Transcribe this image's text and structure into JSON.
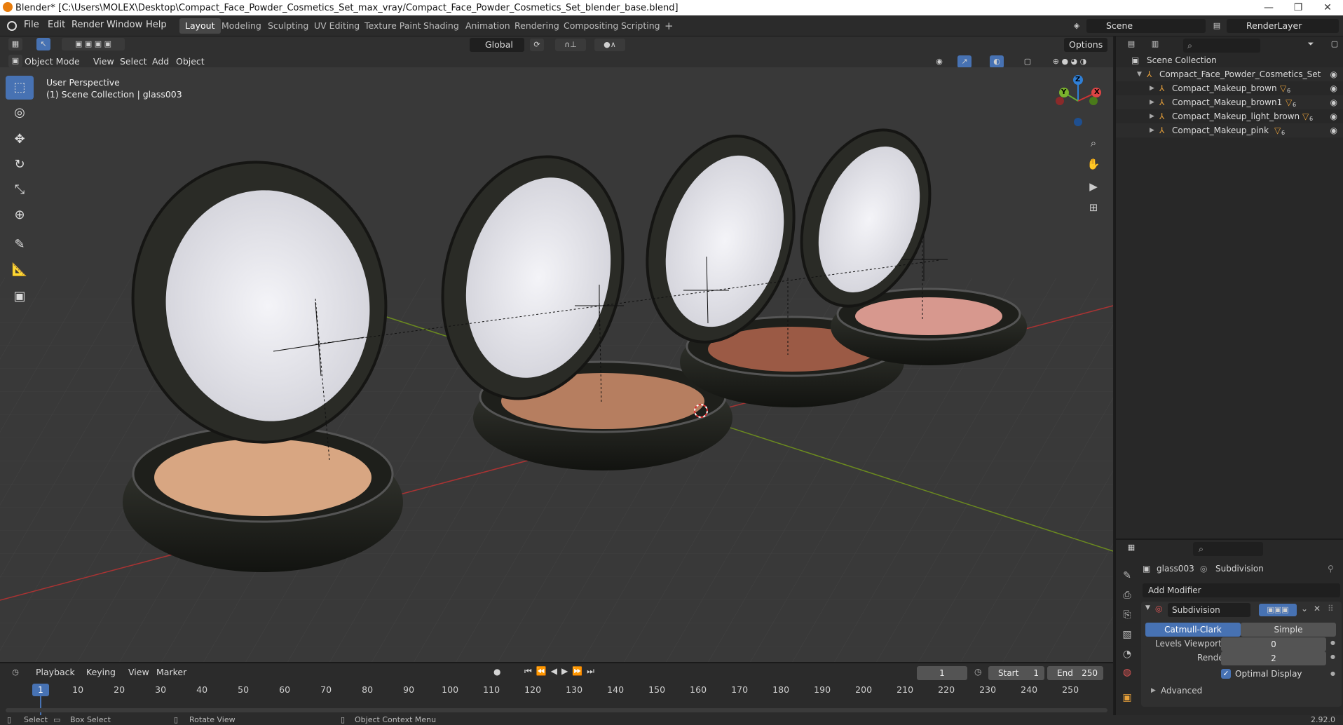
{
  "window": {
    "title": "Blender* [C:\\Users\\MOLEX\\Desktop\\Compact_Face_Powder_Cosmetics_Set_max_vray/Compact_Face_Powder_Cosmetics_Set_blender_base.blend]",
    "minimize": "—",
    "maximize": "❐",
    "close": "✕"
  },
  "menu": {
    "file": "File",
    "edit": "Edit",
    "render": "Render",
    "window": "Window",
    "help": "Help"
  },
  "workspaces": [
    "Layout",
    "Modeling",
    "Sculpting",
    "UV Editing",
    "Texture Paint",
    "Shading",
    "Animation",
    "Rendering",
    "Compositing",
    "Scripting"
  ],
  "add_workspace": "+",
  "scene": {
    "name": "Scene",
    "render_layer": "RenderLayer"
  },
  "vp_header": {
    "transform_orientation": "Global",
    "options": "Options",
    "mode": "Object Mode",
    "view": "View",
    "select": "Select",
    "add": "Add",
    "object": "Object"
  },
  "overlay": {
    "perspective": "User Perspective",
    "collection": "(1) Scene Collection | glass003"
  },
  "gizmo": {
    "z": "Z",
    "y": "Y",
    "x": "X"
  },
  "outliner": {
    "root": "Scene Collection",
    "collection": "Compact_Face_Powder_Cosmetics_Set",
    "items": [
      {
        "label": "Compact_Makeup_brown",
        "count": "6"
      },
      {
        "label": "Compact_Makeup_brown1",
        "count": "6"
      },
      {
        "label": "Compact_Makeup_light_brown",
        "count": "6"
      },
      {
        "label": "Compact_Makeup_pink",
        "count": "6"
      }
    ]
  },
  "properties": {
    "object": "glass003",
    "modifier_context": "Subdivision",
    "add_modifier": "Add Modifier",
    "modifier_name": "Subdivision",
    "catmull": "Catmull-Clark",
    "simple": "Simple",
    "levels_viewport_label": "Levels Viewport",
    "levels_viewport": "0",
    "render_label": "Render",
    "render_levels": "2",
    "optimal_display": "Optimal Display",
    "advanced": "Advanced"
  },
  "timeline": {
    "playback": "Playback",
    "keying": "Keying",
    "view": "View",
    "marker": "Marker",
    "current_frame": "1",
    "start_label": "Start",
    "start": "1",
    "end_label": "End",
    "end": "250",
    "ticks": [
      "10",
      "20",
      "30",
      "40",
      "50",
      "60",
      "70",
      "80",
      "90",
      "100",
      "110",
      "120",
      "130",
      "140",
      "150",
      "160",
      "170",
      "180",
      "190",
      "200",
      "210",
      "220",
      "230",
      "240",
      "250"
    ],
    "playhead": "1"
  },
  "status": {
    "select": "Select",
    "box_select": "Box Select",
    "rotate_view": "Rotate View",
    "context_menu": "Object Context Menu",
    "version": "2.92.0"
  }
}
